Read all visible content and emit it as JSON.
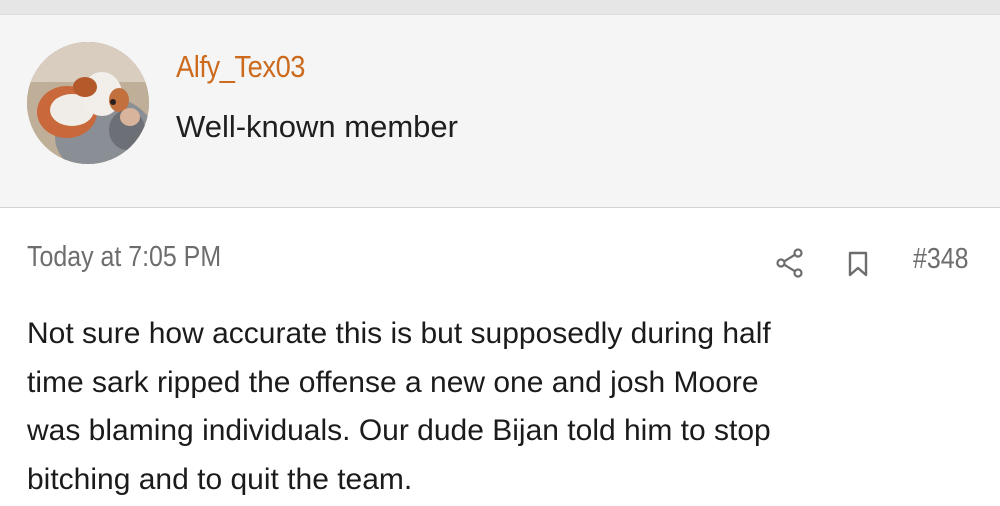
{
  "user": {
    "username": "Alfy_Tex03",
    "title": "Well-known member",
    "avatar_icon": "user-avatar-dog-photo"
  },
  "post": {
    "timestamp": "Today at 7:05 PM",
    "number": "#348",
    "share_icon": "share-icon",
    "bookmark_icon": "bookmark-icon",
    "body_lines": [
      "Not sure how accurate this is but supposedly during half",
      "time sark ripped the offense a new one and josh Moore",
      "was blaming individuals. Our dude Bijan told him to stop",
      "bitching and to quit the team."
    ]
  },
  "colors": {
    "username": "#cc6a1e",
    "meta_text": "#6d6d6d",
    "body_text": "#1b1b1b",
    "header_bg": "#f5f5f5"
  }
}
